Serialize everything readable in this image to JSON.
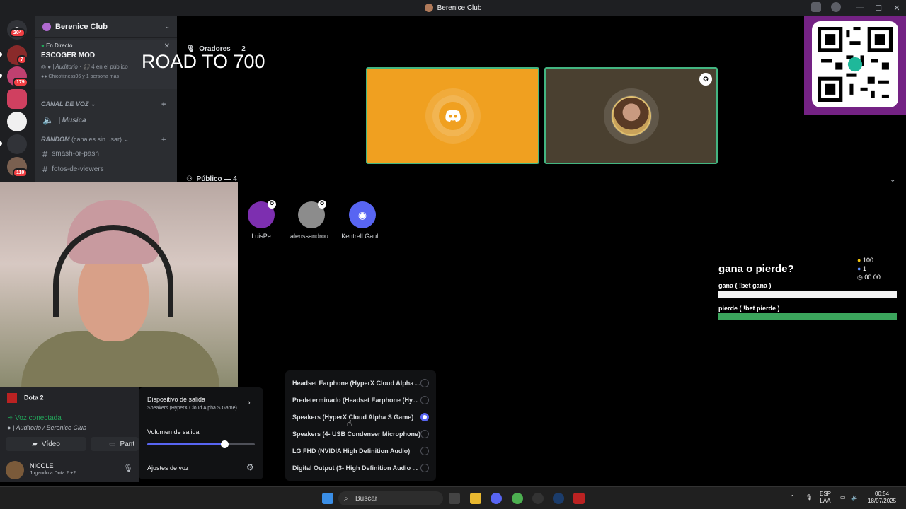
{
  "window": {
    "title": "Berenice Club"
  },
  "servers": {
    "badges": [
      "204",
      "7",
      "179",
      "110"
    ]
  },
  "sidebar": {
    "server_name": "Berenice Club",
    "live": {
      "tag": "En Directo",
      "title": "ESCOGER MOD",
      "channel": "| Auditorio",
      "listeners": "4 en el público",
      "watchers": "Chicofitness96 y 1 persona más"
    },
    "voice_category": "CANAL DE VOZ",
    "voice_channel": "| Musica",
    "random_category": "RANDOM",
    "random_note": "(canales sin usar)",
    "channels": [
      "smash-or-pash",
      "fotos-de-viewers"
    ]
  },
  "stage": {
    "overlay_text": "ROAD TO 700",
    "speakers_label": "Oradores — 2",
    "audience_label": "Público — 4",
    "audience": [
      {
        "name": "LuisPe",
        "color": "#7d2fb0"
      },
      {
        "name": "alenssandrou...",
        "color": "#8c8c8c"
      },
      {
        "name": "Kentrell Gaul...",
        "color": "#5865f2"
      }
    ]
  },
  "poll": {
    "question": "gana o pierde?",
    "coins": "100",
    "people": "1",
    "timer": "00:00",
    "options": [
      {
        "label": "gana ( !bet gana )",
        "share": 0,
        "color": "#f2f2f2"
      },
      {
        "label": "pierde ( !bet pierde )",
        "share": 1,
        "color": "#3ba55c"
      }
    ]
  },
  "userpanel": {
    "activity": "Dota 2",
    "voice_status": "Voz conectada",
    "voice_channel": "| Auditorio / Berenice Club",
    "video_label": "Vídeo",
    "screen_label": "Pant",
    "username": "NICOLE",
    "user_status": "Jugando a Dota 2 +2"
  },
  "popout": {
    "output_device_label": "Dispositivo de salida",
    "output_device_value": "Speakers (HyperX Cloud Alpha S Game)",
    "volume_label": "Volumen de salida",
    "volume_level": 0.72,
    "voice_settings": "Ajustes de voz"
  },
  "devices": {
    "selected_index": 2,
    "items": [
      "Headset Earphone (HyperX Cloud Alpha ...",
      "Predeterminado (Headset Earphone (Hy...",
      "Speakers (HyperX Cloud Alpha S Game)",
      "Speakers (4- USB Condenser Microphone)",
      "LG FHD (NVIDIA High Definition Audio)",
      "Digital Output (3- High Definition Audio ..."
    ]
  },
  "taskbar": {
    "search_placeholder": "Buscar",
    "lang": "ESP",
    "lang2": "LAA",
    "time": "00:54",
    "date": "18/07/2025"
  },
  "colors": {
    "accent": "#5865f2",
    "green": "#23a55a",
    "orange": "#f0a020"
  }
}
